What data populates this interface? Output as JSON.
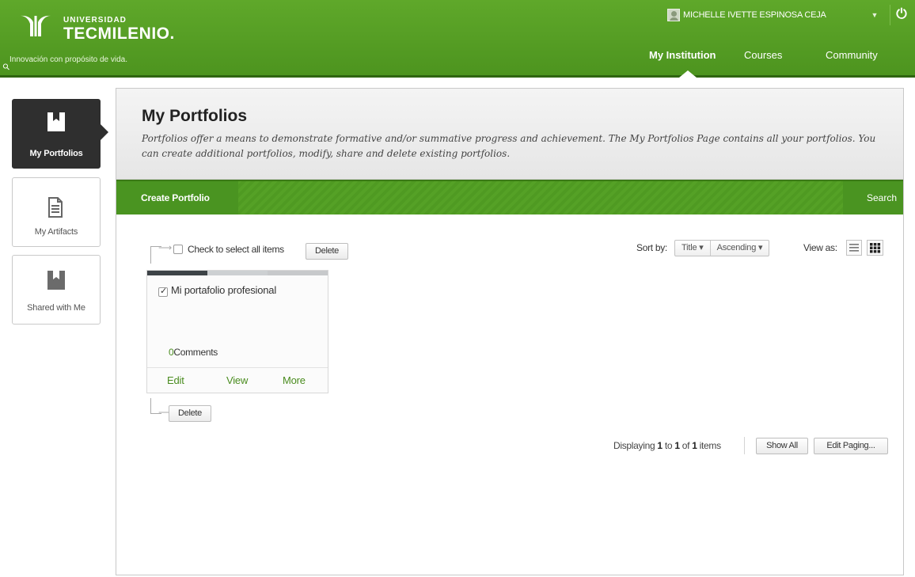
{
  "header": {
    "logo": {
      "line1": "UNIVERSIDAD",
      "line2": "TECMILENIO."
    },
    "tagline": "Innovación con propósito de vida.",
    "user_name": "MICHELLE IVETTE ESPINOSA CEJA",
    "user_menu_icon": "caret-down-icon",
    "power_icon": "power-icon",
    "nav": [
      {
        "label": "My Institution",
        "active": true
      },
      {
        "label": "Courses",
        "active": false
      },
      {
        "label": "Community",
        "active": false
      }
    ]
  },
  "sidebar": {
    "tabs": [
      {
        "label": "My Portfolios",
        "icon": "portfolio-icon",
        "active": true
      },
      {
        "label": "My Artifacts",
        "icon": "document-icon",
        "active": false
      },
      {
        "label": "Shared with Me",
        "icon": "portfolio-icon",
        "active": false
      }
    ]
  },
  "page": {
    "title": "My Portfolios",
    "description": "Portfolios offer a means to demonstrate formative and/or summative progress and achievement. The My Portfolios Page contains all your portfolios. You can create additional portfolios, modify, share and delete existing portfolios."
  },
  "actionbar": {
    "create_label": "Create Portfolio",
    "search_label": "Search"
  },
  "list": {
    "select_all_label": "Check to select all items",
    "delete_label": "Delete",
    "sort_by_label": "Sort by:",
    "sort_field": "Title",
    "sort_order": "Ascending",
    "view_as_label": "View as:",
    "view_mode": "grid",
    "items": [
      {
        "title": "Mi portafolio profesional",
        "checked": true,
        "comments_count": "0",
        "comments_label": "Comments",
        "actions": [
          "Edit",
          "View",
          "More"
        ]
      }
    ],
    "pager": {
      "prefix": "Displaying",
      "from": "1",
      "to_word": "to",
      "to": "1",
      "of_word": "of",
      "total": "1",
      "suffix": "items"
    },
    "show_all_label": "Show All",
    "edit_paging_label": "Edit Paging..."
  },
  "colors": {
    "brand_green": "#4d941f",
    "dark_tab": "#2f2f2f",
    "link_green": "#4a8c1f"
  }
}
